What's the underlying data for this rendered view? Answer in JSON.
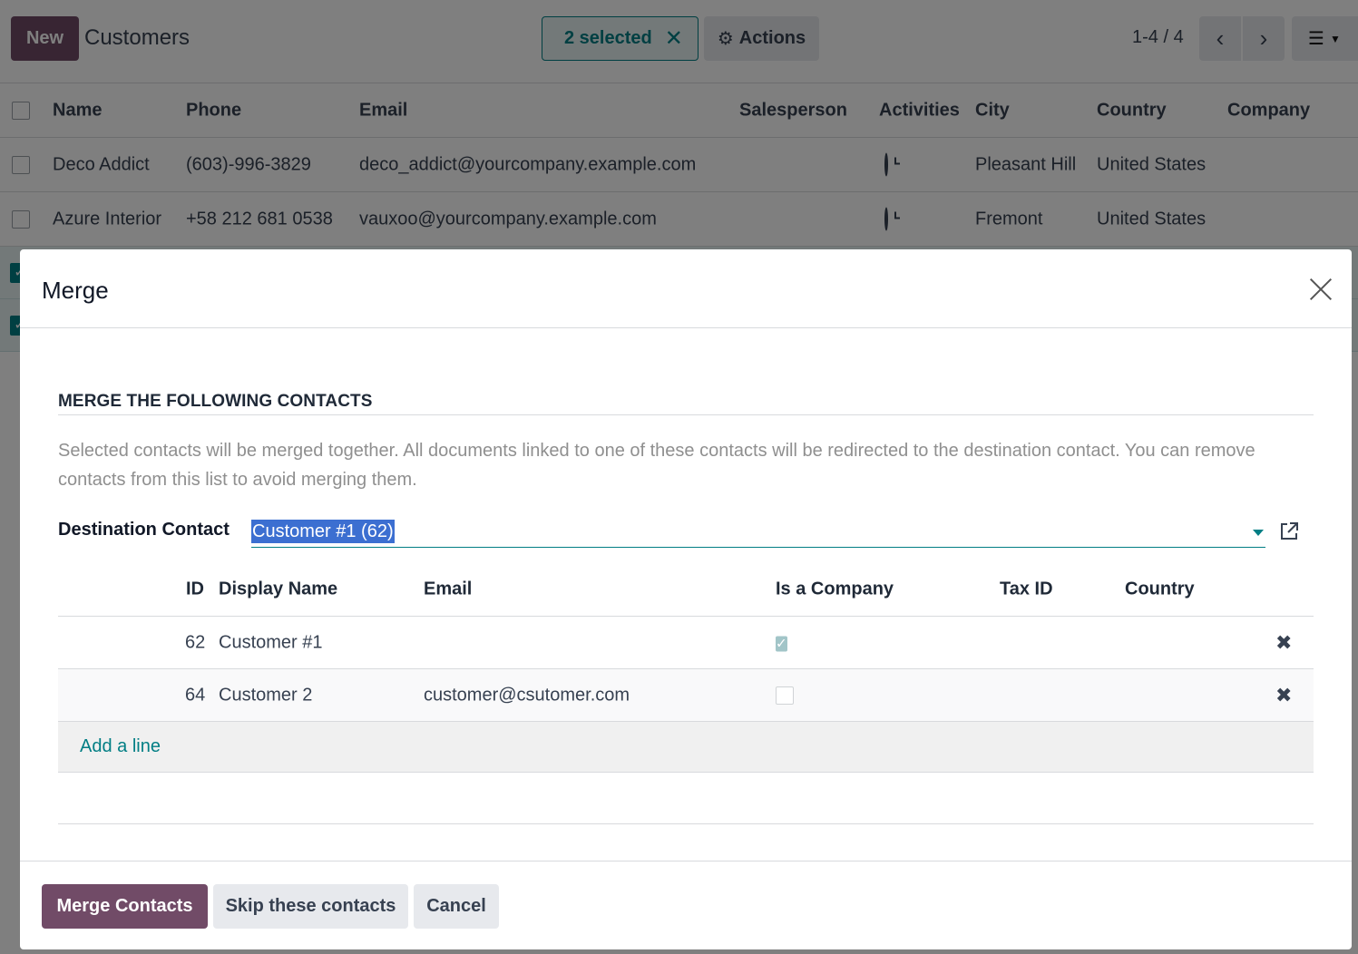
{
  "control_panel": {
    "new_label": "New",
    "title": "Customers",
    "selected_label": "2 selected",
    "clear_icon": "close-icon",
    "actions_label": "Actions",
    "actions_icon": "gear-icon",
    "pager": "1-4 / 4"
  },
  "list": {
    "columns": [
      "Name",
      "Phone",
      "Email",
      "Salesperson",
      "Activities",
      "City",
      "Country",
      "Company"
    ],
    "rows": [
      {
        "name": "Deco Addict",
        "phone": "(603)-996-3829",
        "email": "deco_addict@yourcompany.example.com",
        "city": "Pleasant Hill",
        "country": "United States"
      },
      {
        "name": "Azure Interior",
        "phone": "+58 212 681 0538",
        "email": "vauxoo@yourcompany.example.com",
        "city": "Fremont",
        "country": "United States"
      }
    ]
  },
  "modal": {
    "title": "Merge",
    "section_title": "MERGE THE FOLLOWING CONTACTS",
    "description": "Selected contacts will be merged together. All documents linked to one of these contacts will be redirected to the destination contact. You can remove contacts from this list to avoid merging them.",
    "destination_label": "Destination Contact",
    "destination_value": "Customer #1 (62)",
    "table": {
      "headers": {
        "id": "ID",
        "display_name": "Display Name",
        "email": "Email",
        "is_company": "Is a Company",
        "tax_id": "Tax ID",
        "country": "Country"
      },
      "rows": [
        {
          "id": "62",
          "display_name": "Customer #1",
          "email": "",
          "is_company": true
        },
        {
          "id": "64",
          "display_name": "Customer 2",
          "email": "customer@csutomer.com",
          "is_company": false
        }
      ],
      "add_line": "Add a line"
    },
    "buttons": {
      "merge": "Merge Contacts",
      "skip": "Skip these contacts",
      "cancel": "Cancel"
    }
  },
  "colors": {
    "brand": "#714b67",
    "accent": "#017e84"
  }
}
